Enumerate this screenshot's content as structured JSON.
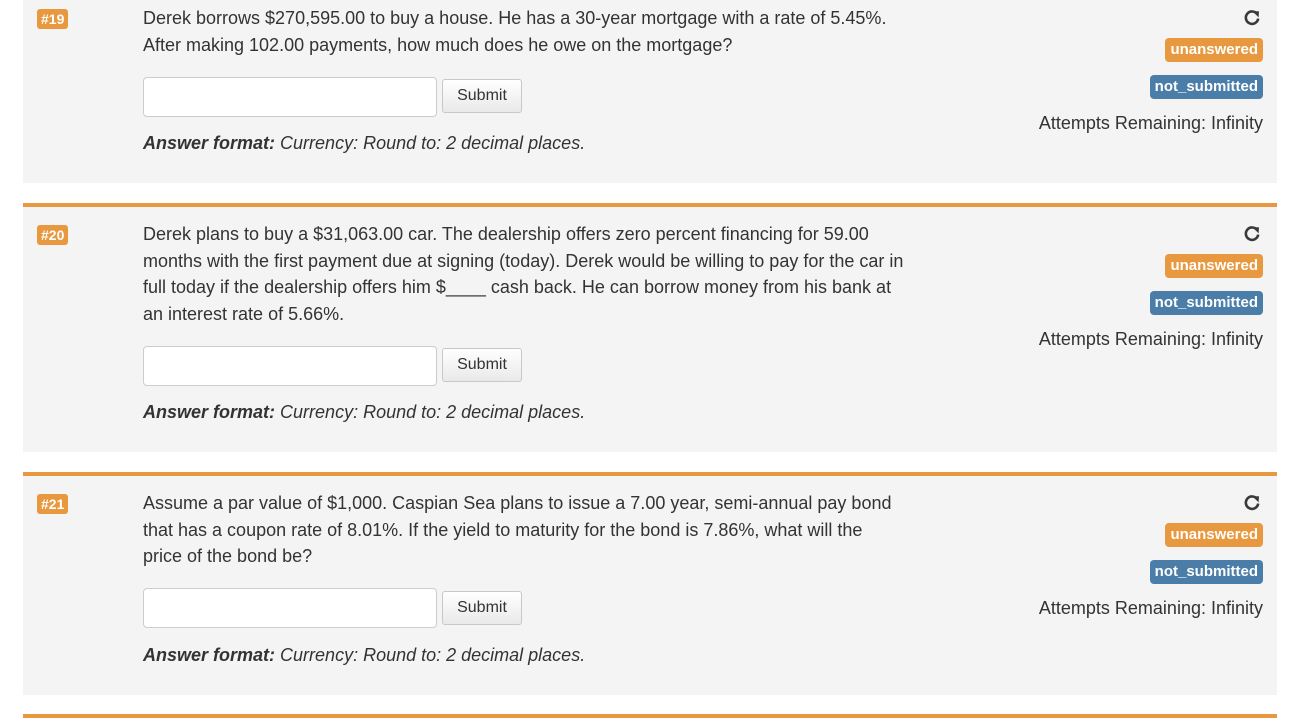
{
  "questions": [
    {
      "number": "#19",
      "text_lines": [
        "Derek borrows $270,595.00 to buy a house. He has a 30-year mortgage with a rate of 5.45%.",
        "After making 102.00 payments, how much does he owe on the mortgage?"
      ],
      "input_value": "",
      "submit_label": "Submit",
      "format_label": "Answer format:",
      "format_value": "Currency: Round to: 2 decimal places.",
      "status": "unanswered",
      "submission": "not_submitted",
      "attempts_label": "Attempts Remaining:",
      "attempts_value": "Infinity"
    },
    {
      "number": "#20",
      "text_lines": [
        "Derek plans to buy a $31,063.00 car. The dealership offers zero percent financing for 59.00",
        "months with the first payment due at signing (today). Derek would be willing to pay for the car in",
        "full today if the dealership offers him $____ cash back. He can borrow money from his bank at",
        "an interest rate of 5.66%."
      ],
      "input_value": "",
      "submit_label": "Submit",
      "format_label": "Answer format:",
      "format_value": "Currency: Round to: 2 decimal places.",
      "status": "unanswered",
      "submission": "not_submitted",
      "attempts_label": "Attempts Remaining:",
      "attempts_value": "Infinity"
    },
    {
      "number": "#21",
      "text_lines": [
        "Assume a par value of $1,000. Caspian Sea plans to issue a 7.00 year, semi-annual pay bond",
        "that has a coupon rate of 8.01%. If the yield to maturity for the bond is 7.86%, what will the",
        "price of the bond be?"
      ],
      "input_value": "",
      "submit_label": "Submit",
      "format_label": "Answer format:",
      "format_value": "Currency: Round to: 2 decimal places.",
      "status": "unanswered",
      "submission": "not_submitted",
      "attempts_label": "Attempts Remaining:",
      "attempts_value": "Infinity"
    }
  ],
  "colors": {
    "accent_orange": "#e8983e",
    "submitted_blue": "#4a7ea8",
    "card_bg": "#f4f4f4"
  },
  "icons": {
    "retry": "refresh-icon"
  }
}
